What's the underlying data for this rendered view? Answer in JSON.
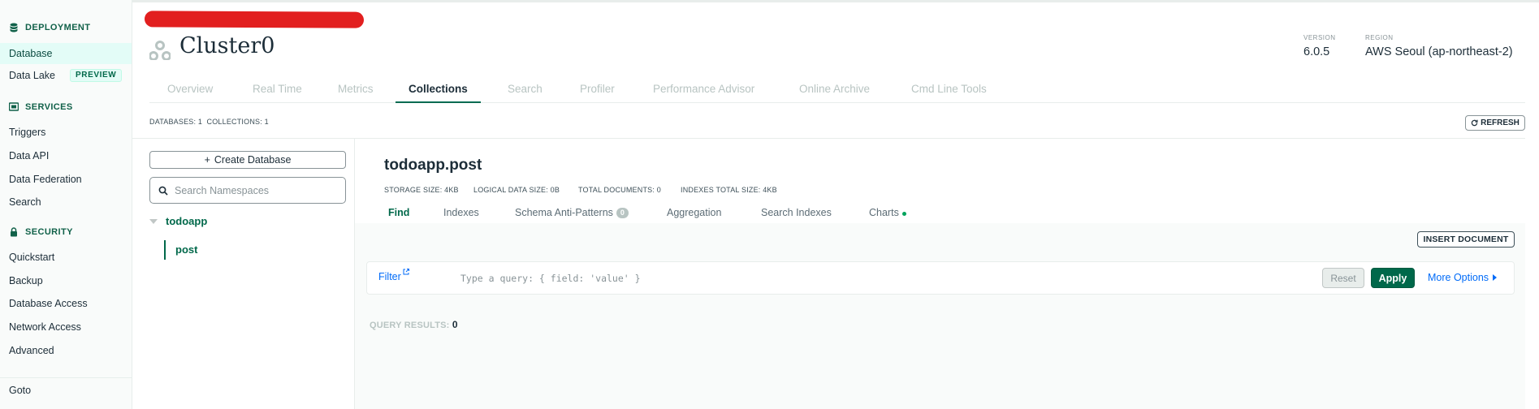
{
  "sidebar": {
    "sections": {
      "deployment": "DEPLOYMENT",
      "services": "SERVICES",
      "security": "SECURITY"
    },
    "items": {
      "database": "Database",
      "data_lake": "Data Lake",
      "preview_badge": "PREVIEW",
      "triggers": "Triggers",
      "data_api": "Data API",
      "data_federation": "Data Federation",
      "search": "Search",
      "quickstart": "Quickstart",
      "backup": "Backup",
      "database_access": "Database Access",
      "network_access": "Network Access",
      "advanced": "Advanced",
      "goto": "Goto"
    }
  },
  "header": {
    "cluster_name": "Cluster0",
    "version_label": "VERSION",
    "version_value": "6.0.5",
    "region_label": "REGION",
    "region_value": "AWS Seoul (ap-northeast-2)"
  },
  "tabs": [
    "Overview",
    "Real Time",
    "Metrics",
    "Collections",
    "Search",
    "Profiler",
    "Performance Advisor",
    "Online Archive",
    "Cmd Line Tools"
  ],
  "active_tab": "Collections",
  "counts": {
    "databases_label": "DATABASES:",
    "databases_value": "1",
    "collections_label": "COLLECTIONS:",
    "collections_value": "1"
  },
  "refresh_label": "REFRESH",
  "namespaces": {
    "create_label": "Create Database",
    "search_placeholder": "Search Namespaces",
    "database": "todoapp",
    "collection": "post"
  },
  "collection": {
    "title": "todoapp.post",
    "storage_size": "STORAGE SIZE: 4KB",
    "logical_size": "LOGICAL DATA SIZE: 0B",
    "total_documents": "TOTAL DOCUMENTS: 0",
    "indexes_size": "INDEXES TOTAL SIZE: 4KB",
    "subtabs": {
      "find": "Find",
      "indexes": "Indexes",
      "schema": "Schema Anti-Patterns",
      "schema_count": "0",
      "aggregation": "Aggregation",
      "search_indexes": "Search Indexes",
      "charts": "Charts"
    },
    "insert_label": "INSERT DOCUMENT",
    "filter_label": "Filter",
    "query_placeholder": "Type a query: { field: 'value' }",
    "reset_label": "Reset",
    "apply_label": "Apply",
    "more_options_label": "More Options",
    "query_results_label": "QUERY RESULTS:",
    "query_results_value": "0"
  },
  "colors": {
    "brand_green": "#00684a",
    "link_blue": "#016bf8",
    "redaction": "#e21f1f"
  }
}
